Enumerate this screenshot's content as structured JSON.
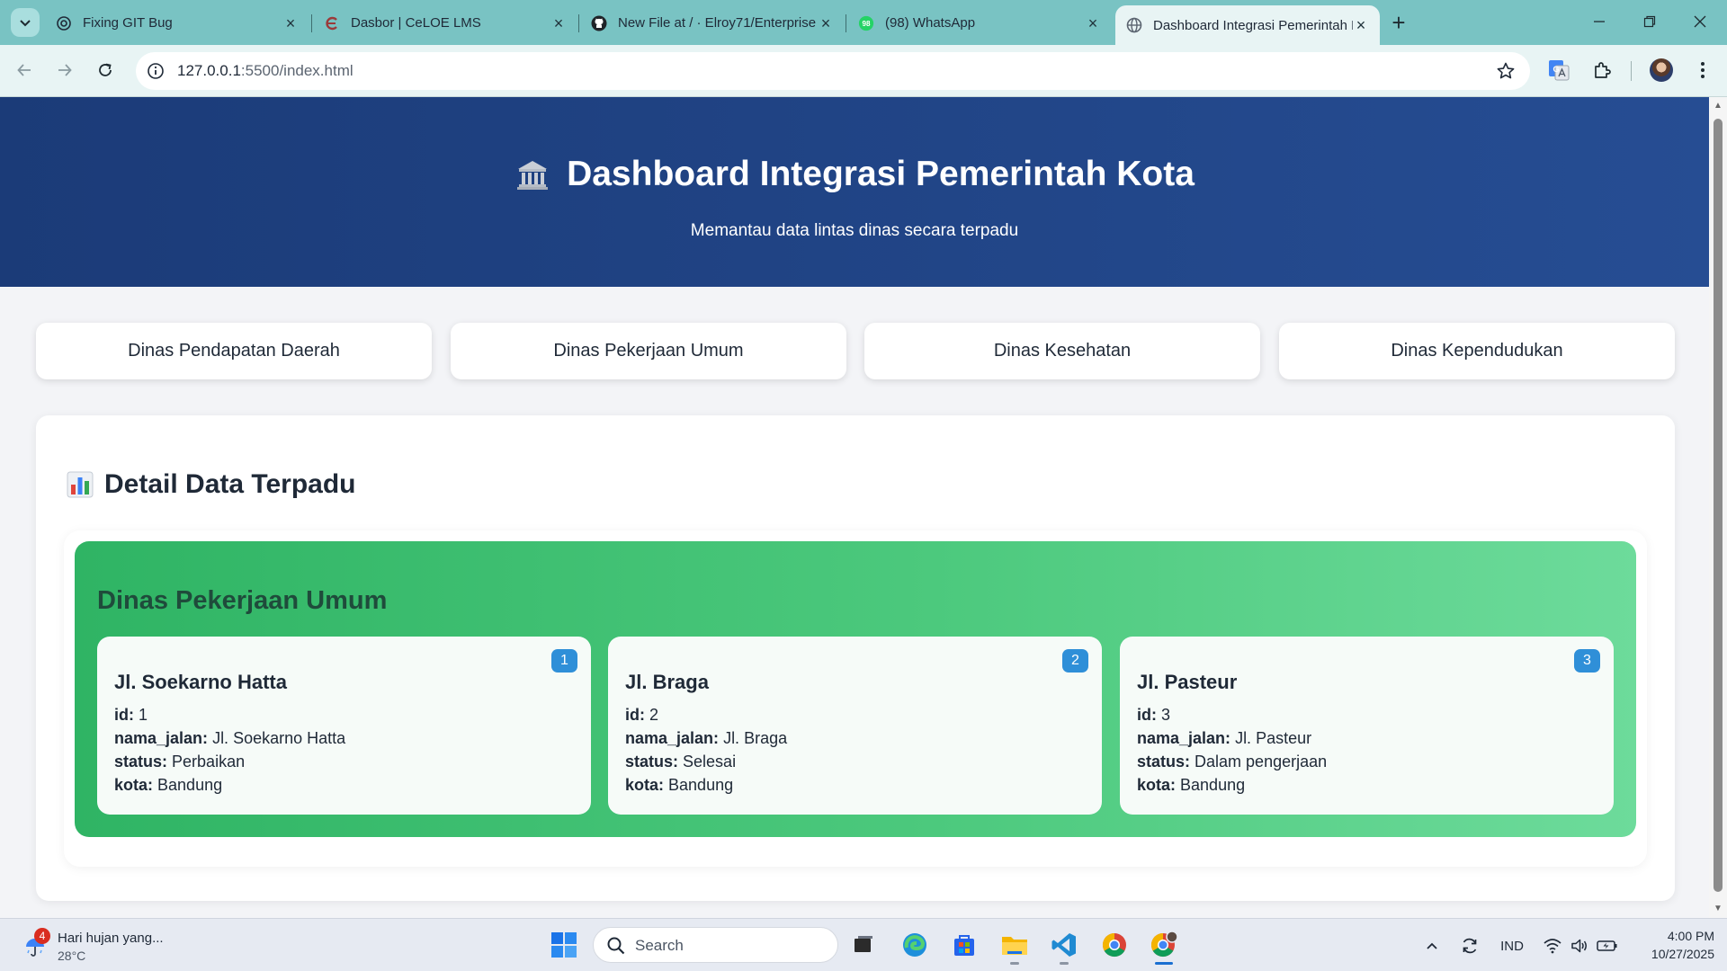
{
  "browser": {
    "tabs": [
      {
        "title": "Fixing GIT Bug",
        "icon": "openai-icon"
      },
      {
        "title": "Dasbor | CeLOE LMS",
        "icon": "celoe-icon"
      },
      {
        "title": "New File at / · Elroy71/Enterprise",
        "icon": "github-icon"
      },
      {
        "title": "(98) WhatsApp",
        "icon": "whatsapp-icon",
        "badge": "98"
      },
      {
        "title": "Dashboard Integrasi Pemerintah Kota",
        "icon": "globe-icon",
        "active": true
      }
    ],
    "url_host": "127.0.0.1",
    "url_rest": ":5500/index.html"
  },
  "header": {
    "title": "Dashboard Integrasi Pemerintah Kota",
    "subtitle": "Memantau data lintas dinas secara terpadu"
  },
  "dinas_buttons": [
    "Dinas Pendapatan Daerah",
    "Dinas Pekerjaan Umum",
    "Dinas Kesehatan",
    "Dinas Kependudukan"
  ],
  "detail": {
    "title": "Detail Data Terpadu",
    "section_title": "Dinas Pekerjaan Umum",
    "field_labels": {
      "id": "id:",
      "nama_jalan": "nama_jalan:",
      "status": "status:",
      "kota": "kota:"
    },
    "items": [
      {
        "badge": "1",
        "name": "Jl. Soekarno Hatta",
        "id": "1",
        "nama_jalan": "Jl. Soekarno Hatta",
        "status": "Perbaikan",
        "kota": "Bandung"
      },
      {
        "badge": "2",
        "name": "Jl. Braga",
        "id": "2",
        "nama_jalan": "Jl. Braga",
        "status": "Selesai",
        "kota": "Bandung"
      },
      {
        "badge": "3",
        "name": "Jl. Pasteur",
        "id": "3",
        "nama_jalan": "Jl. Pasteur",
        "status": "Dalam pengerjaan",
        "kota": "Bandung"
      }
    ]
  },
  "taskbar": {
    "weather_desc": "Hari hujan yang...",
    "weather_temp": "28°C",
    "weather_badge": "4",
    "search_label": "Search",
    "language": "IND",
    "time": "4:00 PM",
    "date": "10/27/2025"
  },
  "colors": {
    "header_start": "#1b3b78",
    "header_end": "#264d93",
    "green_start": "#2fb464",
    "green_end": "#6ddb9b",
    "badge": "#2f8fd8"
  }
}
